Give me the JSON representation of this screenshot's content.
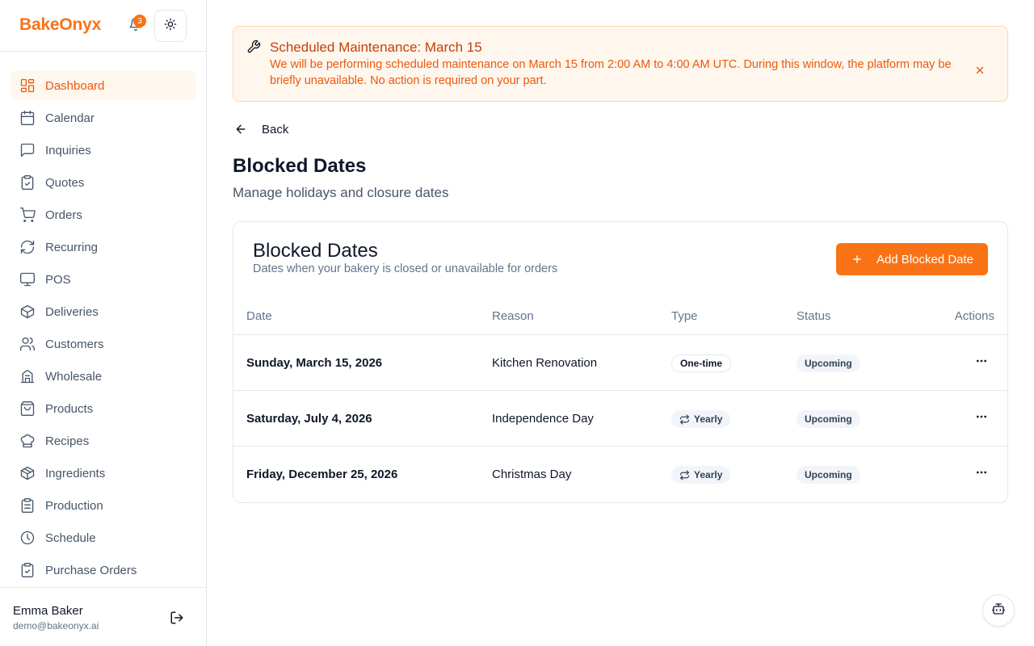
{
  "app": {
    "brand": "BakeOnyx",
    "notification_count": "3",
    "accent": "#f97316"
  },
  "sidebar": {
    "items": [
      {
        "label": "Dashboard",
        "icon": "dashboard-icon",
        "active": true
      },
      {
        "label": "Calendar",
        "icon": "calendar-icon"
      },
      {
        "label": "Inquiries",
        "icon": "message-icon"
      },
      {
        "label": "Quotes",
        "icon": "clipboard-icon"
      },
      {
        "label": "Orders",
        "icon": "cart-icon"
      },
      {
        "label": "Recurring",
        "icon": "refresh-icon"
      },
      {
        "label": "POS",
        "icon": "monitor-icon"
      },
      {
        "label": "Deliveries",
        "icon": "package-icon"
      },
      {
        "label": "Customers",
        "icon": "users-icon"
      },
      {
        "label": "Wholesale",
        "icon": "building-icon"
      },
      {
        "label": "Products",
        "icon": "bag-icon"
      },
      {
        "label": "Recipes",
        "icon": "chef-hat-icon"
      },
      {
        "label": "Ingredients",
        "icon": "box-icon"
      },
      {
        "label": "Production",
        "icon": "clipboard-list-icon"
      },
      {
        "label": "Schedule",
        "icon": "clock-icon"
      },
      {
        "label": "Purchase Orders",
        "icon": "clipboard-check-icon"
      }
    ]
  },
  "user": {
    "name": "Emma Baker",
    "email": "demo@bakeonyx.ai"
  },
  "banner": {
    "title": "Scheduled Maintenance: March 15",
    "text": "We will be performing scheduled maintenance on March 15 from 2:00 AM to 4:00 AM UTC. During this window, the platform may be briefly unavailable. No action is required on your part."
  },
  "page": {
    "back_label": "Back",
    "title": "Blocked Dates",
    "subtitle": "Manage holidays and closure dates"
  },
  "card": {
    "title": "Blocked Dates",
    "description": "Dates when your bakery is closed or unavailable for orders",
    "add_button": "Add Blocked Date"
  },
  "table": {
    "headers": {
      "date": "Date",
      "reason": "Reason",
      "type": "Type",
      "status": "Status",
      "actions": "Actions"
    },
    "rows": [
      {
        "date": "Sunday, March 15, 2026",
        "reason": "Kitchen Renovation",
        "type": "One-time",
        "status": "Upcoming"
      },
      {
        "date": "Saturday, July 4, 2026",
        "reason": "Independence Day",
        "type": "Yearly",
        "status": "Upcoming"
      },
      {
        "date": "Friday, December 25, 2026",
        "reason": "Christmas Day",
        "type": "Yearly",
        "status": "Upcoming"
      }
    ]
  }
}
